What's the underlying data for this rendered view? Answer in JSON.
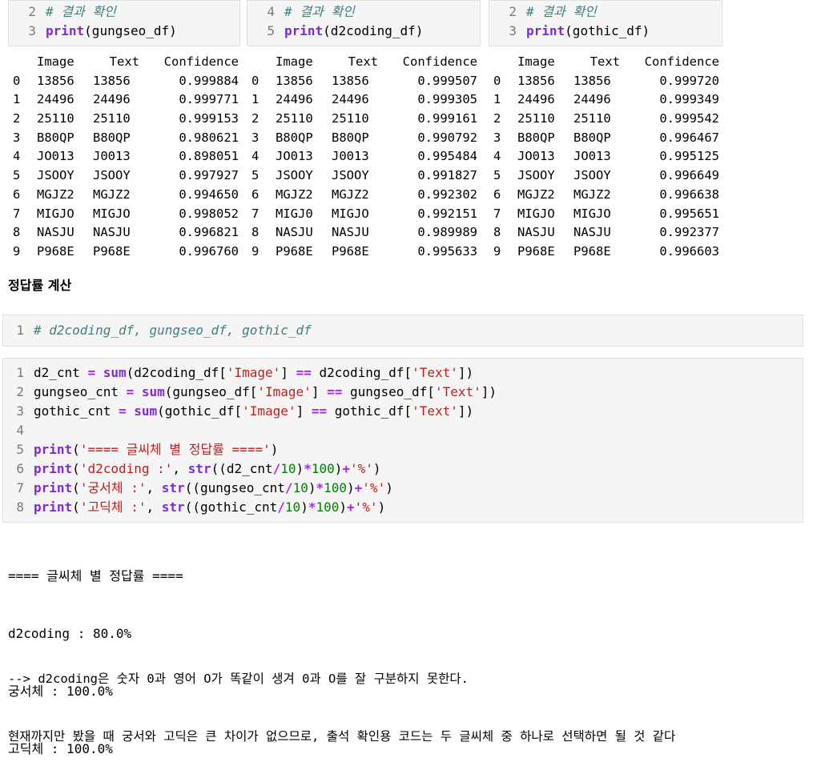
{
  "top_cells": [
    {
      "lines": [
        {
          "n": "2",
          "comment": "# 결과 확인"
        },
        {
          "n": "3",
          "fn": "print",
          "arg": "(gungseo_df)"
        }
      ]
    },
    {
      "lines": [
        {
          "n": "4",
          "comment": "# 결과 확인"
        },
        {
          "n": "5",
          "fn": "print",
          "arg": "(d2coding_df)"
        }
      ]
    },
    {
      "lines": [
        {
          "n": "2",
          "comment": "# 결과 확인"
        },
        {
          "n": "3",
          "fn": "print",
          "arg": "(gothic_df)"
        }
      ]
    }
  ],
  "dataframes": {
    "columns": [
      "Image",
      "Text",
      "Confidence"
    ],
    "tables": [
      {
        "rows": [
          [
            "0",
            "13856",
            "13856",
            "0.999884"
          ],
          [
            "1",
            "24496",
            "24496",
            "0.999771"
          ],
          [
            "2",
            "25110",
            "25110",
            "0.999153"
          ],
          [
            "3",
            "B80QP",
            "B80QP",
            "0.980621"
          ],
          [
            "4",
            "JO013",
            "J0013",
            "0.898051"
          ],
          [
            "5",
            "JSOOY",
            "JSOOY",
            "0.997927"
          ],
          [
            "6",
            "MGJZ2",
            "MGJZ2",
            "0.994650"
          ],
          [
            "7",
            "MIGJO",
            "MIGJO",
            "0.998052"
          ],
          [
            "8",
            "NASJU",
            "NASJU",
            "0.996821"
          ],
          [
            "9",
            "P968E",
            "P968E",
            "0.996760"
          ]
        ]
      },
      {
        "rows": [
          [
            "0",
            "13856",
            "13856",
            "0.999507"
          ],
          [
            "1",
            "24496",
            "24496",
            "0.999305"
          ],
          [
            "2",
            "25110",
            "25110",
            "0.999161"
          ],
          [
            "3",
            "B80QP",
            "B80QP",
            "0.990792"
          ],
          [
            "4",
            "JO013",
            "J0013",
            "0.995484"
          ],
          [
            "5",
            "JSOOY",
            "JSOOY",
            "0.991827"
          ],
          [
            "6",
            "MGJZ2",
            "MGJZ2",
            "0.992302"
          ],
          [
            "7",
            "MIGJ0",
            "MIGJO",
            "0.992151"
          ],
          [
            "8",
            "NASJU",
            "NASJU",
            "0.989989"
          ],
          [
            "9",
            "P968E",
            "P968E",
            "0.995633"
          ]
        ]
      },
      {
        "rows": [
          [
            "0",
            "13856",
            "13856",
            "0.999720"
          ],
          [
            "1",
            "24496",
            "24496",
            "0.999349"
          ],
          [
            "2",
            "25110",
            "25110",
            "0.999542"
          ],
          [
            "3",
            "B80QP",
            "B80QP",
            "0.996467"
          ],
          [
            "4",
            "JO013",
            "JO013",
            "0.995125"
          ],
          [
            "5",
            "JSOOY",
            "JSOOY",
            "0.996649"
          ],
          [
            "6",
            "MGJZ2",
            "MGJZ2",
            "0.996638"
          ],
          [
            "7",
            "MIGJO",
            "MIGJO",
            "0.995651"
          ],
          [
            "8",
            "NASJU",
            "NASJU",
            "0.992377"
          ],
          [
            "9",
            "P968E",
            "P968E",
            "0.996603"
          ]
        ]
      }
    ]
  },
  "heading": "정답률 계산",
  "comment_cell": {
    "n": "1",
    "text": "# d2coding_df, gungseo_df, gothic_df"
  },
  "code_cell": {
    "line_numbers": [
      "1",
      "2",
      "3",
      "4",
      "5",
      "6",
      "7",
      "8"
    ]
  },
  "output_lines": [
    "==== 글씨체 별 정답률 ====",
    "d2coding : 80.0%",
    "궁서체 : 100.0%",
    "고딕체 : 100.0%"
  ],
  "notes": [
    "--> d2coding은 숫자 0과 영어 O가 똑같이 생겨 0과 O를 잘 구분하지 못한다.",
    "현재까지만 봤을 때 궁서와 고딕은 큰 차이가 없으므로, 출석 확인용 코드는 두 글씨체 중 하나로 선택하면 될 것 같다"
  ]
}
